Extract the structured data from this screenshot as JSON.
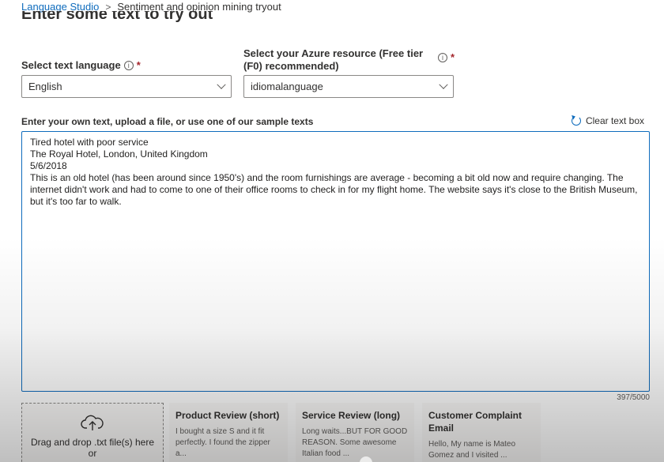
{
  "breadcrumb": {
    "root": "Language Studio",
    "separator": ">",
    "current": "Sentiment and opinion mining tryout"
  },
  "section_title": "Enter some text to try out",
  "language": {
    "label": "Select text language",
    "selected": "English"
  },
  "resource": {
    "label": "Select your Azure resource (Free tier (F0) recommended)",
    "selected": "idiomalanguage"
  },
  "input": {
    "label": "Enter your own text, upload a file, or use one of our sample texts",
    "clear_label": "Clear text box",
    "value": "Tired hotel with poor service\nThe Royal Hotel, London, United Kingdom\n5/6/2018\nThis is an old hotel (has been around since 1950's) and the room furnishings are average - becoming a bit old now and require changing. The internet didn't work and had to come to one of their office rooms to check in for my flight home. The website says it's close to the British Museum, but it's too far to walk.",
    "char_count": "397/5000"
  },
  "upload": {
    "text": "Drag and drop .txt file(s) here",
    "or": "or"
  },
  "samples": [
    {
      "title": "Product Review (short)",
      "text": "I bought a size S and it fit perfectly. I found the zipper a..."
    },
    {
      "title": "Service Review (long)",
      "text": "Long waits...BUT FOR GOOD REASON. Some awesome Italian food ..."
    },
    {
      "title": "Customer Complaint Email",
      "text": "Hello, My name is Mateo Gomez and I visited ..."
    }
  ],
  "colors": {
    "accent": "#0f6cbd",
    "required": "#a4262c"
  }
}
